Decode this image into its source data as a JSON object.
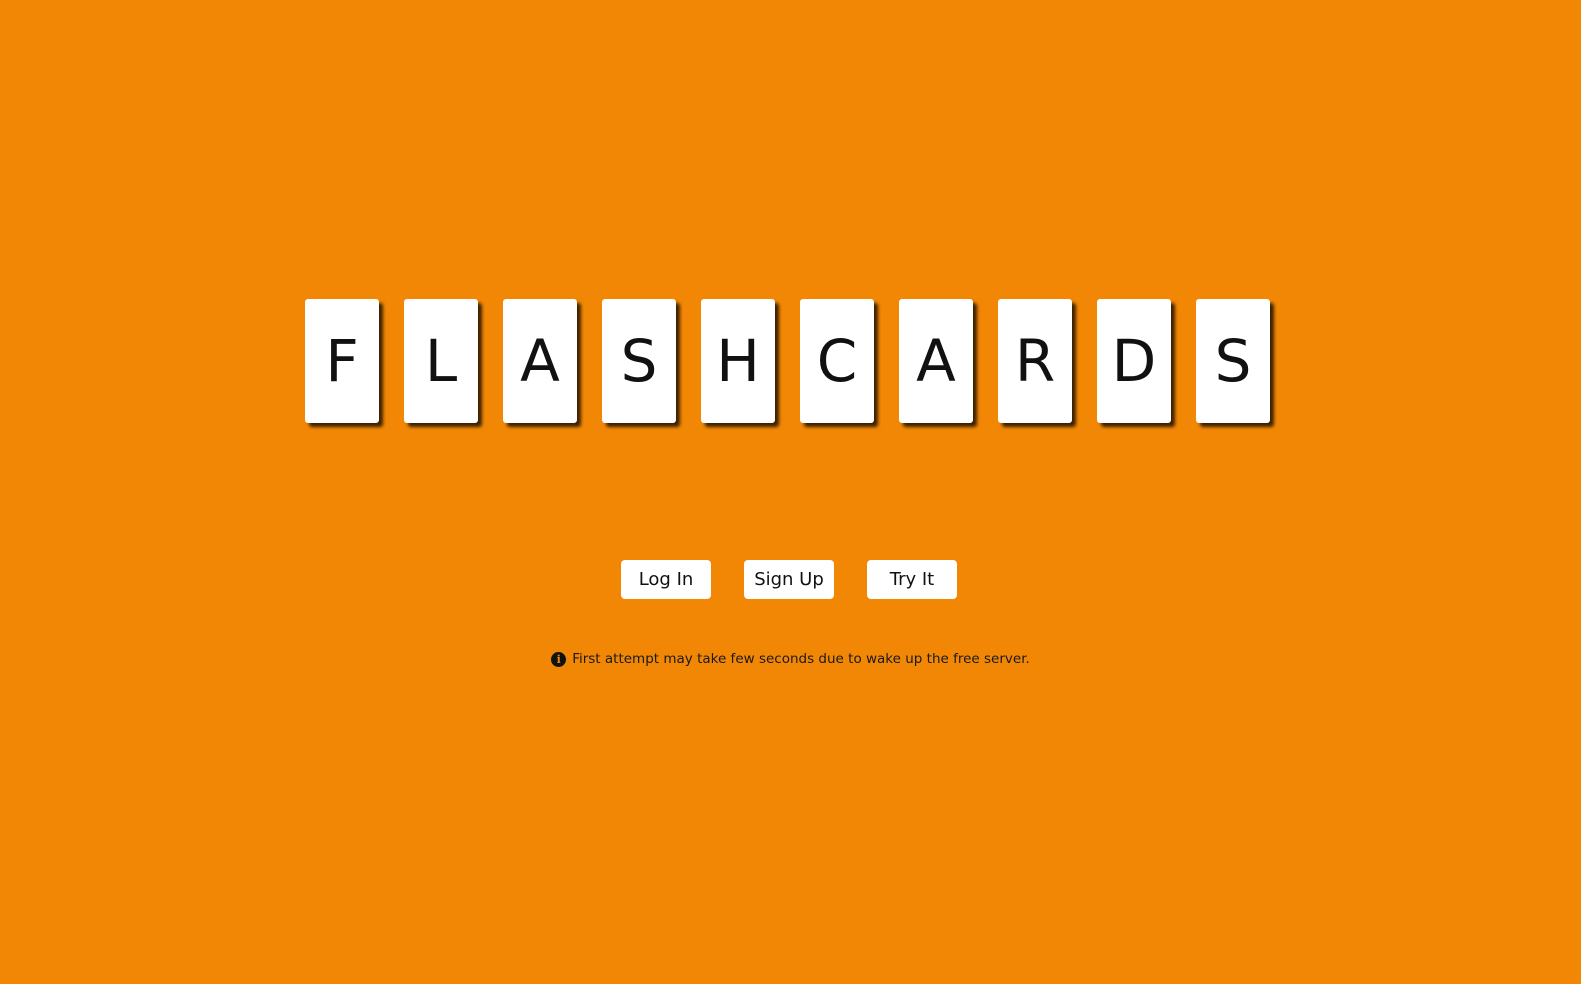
{
  "title_letters": [
    "F",
    "L",
    "A",
    "S",
    "H",
    "C",
    "A",
    "R",
    "D",
    "S"
  ],
  "buttons": {
    "login_label": "Log In",
    "signup_label": "Sign Up",
    "try_label": "Try It"
  },
  "notice": {
    "icon": "info-circle-icon",
    "text": "First attempt may take few seconds due to wake up the free server."
  },
  "colors": {
    "background": "#f28705",
    "card": "#ffffff"
  }
}
